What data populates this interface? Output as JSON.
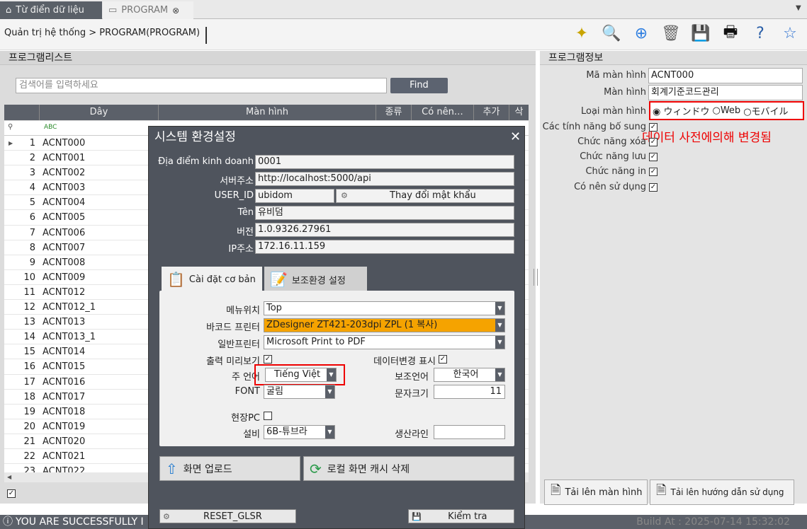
{
  "tabs": [
    {
      "label": "Từ điển dữ liệu"
    },
    {
      "label": "PROGRAM"
    }
  ],
  "breadcrumb": "Quản trị hệ thống > PROGRAM(PROGRAM)",
  "left_panel": {
    "title": "프로그램리스트",
    "search_placeholder": "검색어를 입력하세요",
    "find_label": "Find",
    "columns": [
      "Dây",
      "Màn hình",
      "종류",
      "Có nên…",
      "추가",
      "삭"
    ],
    "rows": [
      {
        "n": "1",
        "code": "ACNT000"
      },
      {
        "n": "2",
        "code": "ACNT001"
      },
      {
        "n": "3",
        "code": "ACNT002"
      },
      {
        "n": "4",
        "code": "ACNT003"
      },
      {
        "n": "5",
        "code": "ACNT004"
      },
      {
        "n": "6",
        "code": "ACNT005"
      },
      {
        "n": "7",
        "code": "ACNT006"
      },
      {
        "n": "8",
        "code": "ACNT007"
      },
      {
        "n": "9",
        "code": "ACNT008"
      },
      {
        "n": "10",
        "code": "ACNT009"
      },
      {
        "n": "11",
        "code": "ACNT012"
      },
      {
        "n": "12",
        "code": "ACNT012_1"
      },
      {
        "n": "13",
        "code": "ACNT013"
      },
      {
        "n": "14",
        "code": "ACNT013_1"
      },
      {
        "n": "15",
        "code": "ACNT014"
      },
      {
        "n": "16",
        "code": "ACNT015"
      },
      {
        "n": "17",
        "code": "ACNT016"
      },
      {
        "n": "18",
        "code": "ACNT017"
      },
      {
        "n": "19",
        "code": "ACNT018"
      },
      {
        "n": "20",
        "code": "ACNT019"
      },
      {
        "n": "21",
        "code": "ACNT020"
      },
      {
        "n": "22",
        "code": "ACNT021"
      },
      {
        "n": "23",
        "code": "ACNT022"
      }
    ]
  },
  "right_panel": {
    "title": "프로그램정보",
    "ma_label": "Mã màn hình",
    "ma_value": "ACNT000",
    "mh_label": "Màn hình",
    "mh_value": "회계기준코드관리",
    "loai_label": "Loại màn hình",
    "radio1": "ウィンドウ",
    "radio2": "Web",
    "radio3": "モバイル",
    "note": "데이터 사전에의해 변경됨",
    "bosung_label": "Các tính năng bổ sung",
    "xoa_label": "Chức năng xóa",
    "luu_label": "Chức năng lưu",
    "in_label": "Chức năng in",
    "sudung_label": "Có nên sử dụng",
    "upload_screen": "Tải lên màn hình",
    "upload_guide": "Tải lên hướng dẫn sử dụng"
  },
  "dialog": {
    "title": "시스템 환경설정",
    "diadiem_label": "Địa điểm kinh doanh",
    "diadiem_value": "0001",
    "server_label": "서버주소",
    "server_value": "http://localhost:5000/api",
    "userid_label": "USER_ID",
    "userid_value": "ubidom",
    "changepw": "Thay đổi mật khẩu",
    "ten_label": "Tên",
    "ten_value": "유비덤",
    "version_label": "버전",
    "version_value": "1.0.9326.27961",
    "ip_label": "IP주소",
    "ip_value": "172.16.11.159",
    "tab1": "Cài đặt cơ bản",
    "tab2": "보조환경 설정",
    "menu_label": "메뉴위치",
    "menu_value": "Top",
    "barcode_label": "바코드 프린터",
    "barcode_value": "ZDesigner ZT421-203dpi ZPL (1 복사)",
    "printer_label": "일반프린터",
    "printer_value": "Microsoft Print to PDF",
    "preview_label": "출력 미리보기",
    "datachange_label": "데이터변경 표시",
    "lang_label": "주 언어",
    "lang_value": "Tiếng Việt",
    "sublang_label": "보조언어",
    "sublang_value": "한국어",
    "font_label": "FONT",
    "font_value": "굴림",
    "fontsize_label": "문자크기",
    "fontsize_value": "11",
    "site_label": "현장PC",
    "equip_label": "설비",
    "equip_value": "6B-튜브라",
    "line_label": "생산라인",
    "line_value": "",
    "upload_btn": "화면 업로드",
    "cache_btn": "로컬 화면 캐시 삭제",
    "reset_btn": "RESET_GLSR",
    "check_btn": "Kiểm tra"
  },
  "status": {
    "message": "YOU ARE SUCCESSFULLY I",
    "build": "Build At : 2025-07-14 15:32:02"
  }
}
